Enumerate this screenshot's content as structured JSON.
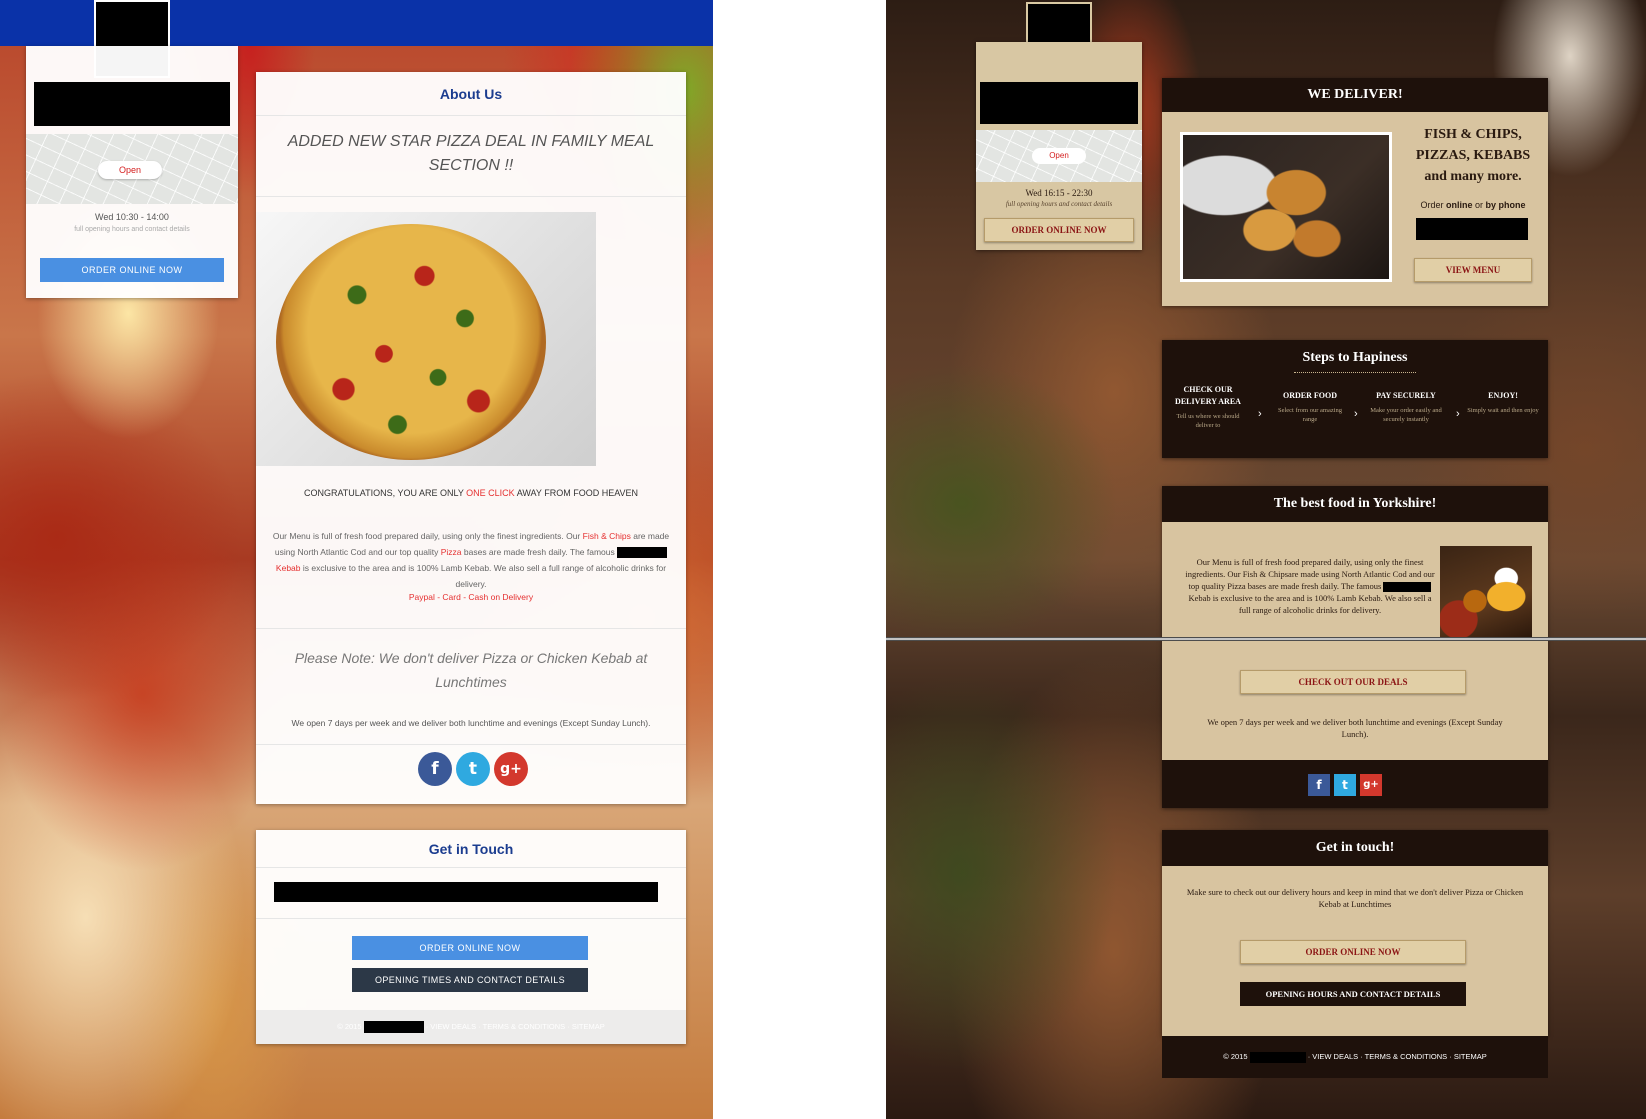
{
  "left": {
    "side": {
      "map_badge": "Open",
      "hours": "Wed 10:30 - 14:00",
      "hours_link": "full opening hours and contact details",
      "order_button": "ORDER ONLINE NOW"
    },
    "about": {
      "title": "About Us",
      "headline": "ADDED NEW STAR PIZZA DEAL IN FAMILY MEAL SECTION !!",
      "congrats_pre": "CONGRATULATIONS, YOU ARE ONLY",
      "congrats_hl": "ONE CLICK",
      "congrats_post": "AWAY FROM FOOD HEAVEN",
      "desc_1": "Our Menu is full of fresh food prepared daily, using only the finest ingredients. Our",
      "desc_fish": "Fish & Chips",
      "desc_2": "are made using North Atlantic Cod and our top quality",
      "desc_pizza": "Pizza",
      "desc_3": "bases are made fresh daily. The famous",
      "desc_kebab": "Kebab",
      "desc_4": "is exclusive to the area and is 100% Lamb Kebab. We also sell a full range of alcoholic drinks for delivery.",
      "payment": "Paypal - Card - Cash on Delivery",
      "note": "Please Note: We don't deliver Pizza or Chicken Kebab at Lunchtimes",
      "open_days": "We open 7 days per week and we deliver both lunchtime and evenings (Except Sunday Lunch)."
    },
    "touch": {
      "title": "Get in Touch",
      "order_button": "ORDER ONLINE NOW",
      "hours_button": "OPENING TIMES AND CONTACT DETAILS",
      "footer_year": "© 2015",
      "footer_links": "· VIEW DEALS · TERMS & CONDITIONS · SITEMAP"
    },
    "colors": {
      "brand_blue": "#0a32a8",
      "button_blue": "#4a90e2",
      "accent_red": "#e53030",
      "heading_blue": "#1b3c8f"
    }
  },
  "right": {
    "side": {
      "map_badge": "Open",
      "hours": "Wed 16:15 - 22:30",
      "hours_link": "full opening hours and contact details",
      "order_button": "ORDER ONLINE NOW"
    },
    "deliver": {
      "title": "WE DELIVER!",
      "tagline_1": "FISH & CHIPS,",
      "tagline_2": "PIZZAS, KEBABS",
      "tagline_3": "and many more.",
      "order_pre": "Order",
      "order_online": "online",
      "order_mid": "or",
      "order_phone": "by phone",
      "menu_button": "VIEW MENU"
    },
    "steps": {
      "title": "Steps to Hapiness",
      "items": [
        {
          "title": "CHECK OUR DELIVERY AREA",
          "desc": "Tell us where we should deliver to"
        },
        {
          "title": "ORDER FOOD",
          "desc": "Select from our amazing range"
        },
        {
          "title": "PAY SECURELY",
          "desc": "Make your order easily and securely instantly"
        },
        {
          "title": "ENJOY!",
          "desc": "Simply wait and then enjoy"
        }
      ]
    },
    "best": {
      "title": "The best food in Yorkshire!",
      "desc_1": "Our Menu is full of fresh food prepared daily, using only the finest ingredients. Our Fish & Chipsare made using North Atlantic Cod and our top quality Pizza bases are made fresh daily. The famous",
      "desc_2": "Kebab is exclusive to the area and is 100% Lamb Kebab. We also sell a full range of alcoholic drinks for delivery.",
      "deals_button": "CHECK OUT OUR DEALS",
      "open_days": "We open 7 days per week and we deliver both lunchtime and evenings (Except Sunday Lunch)."
    },
    "touch": {
      "title": "Get in touch!",
      "text": "Make sure to check out our delivery hours and keep in mind that we don't deliver Pizza or Chicken Kebab at Lunchtimes",
      "order_button": "ORDER ONLINE NOW",
      "hours_button": "OPENING HOURS AND CONTACT DETAILS"
    },
    "footer": {
      "year": "© 2015",
      "links": "· VIEW DEALS · TERMS & CONDITIONS · SITEMAP"
    },
    "colors": {
      "dark_bar": "#1e110b",
      "panel_tan": "#d8c4a0",
      "button_tan": "#e1cfa6",
      "button_text_red": "#8b1414"
    }
  },
  "icons": {
    "facebook_glyph": "f",
    "twitter_glyph": "t",
    "google_glyph": "g+",
    "arrow_glyph": "›"
  }
}
